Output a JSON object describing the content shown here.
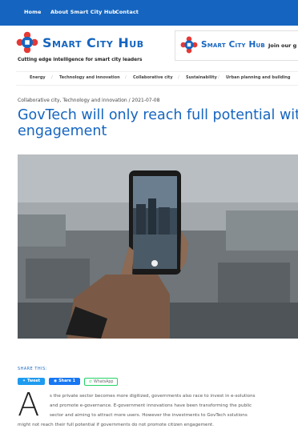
{
  "topnav": {
    "links": [
      "Home",
      "About Smart City Hub",
      "Contact"
    ]
  },
  "brand": {
    "name": "Smart City Hub",
    "tagline": "Cutting edge intelligence for smart city leaders"
  },
  "banner": {
    "brand": "Smart City Hub",
    "cta": "Join our g"
  },
  "categories": [
    "Energy",
    "Technology and innovation",
    "Collaborative city",
    "Sustainability",
    "Urban planning and building"
  ],
  "article": {
    "breadcrumb": "Collaborative city, Technology and innovation / 2021-07-08",
    "title_line1": "GovTech will only reach full potential with",
    "title_line2": "engagement",
    "share_label": "SHARE THIS:",
    "share_buttons": {
      "tweet": "Tweet",
      "share": "Share 1",
      "whatsapp": "WhatsApp"
    },
    "dropcap": "A",
    "body_lines": [
      "s the private sector becomes more digitized, governments also race to invest in e-solutions",
      "and promote e-governance. E-government innovations have been transforming the public",
      "sector and aiming to attract more users. However the investments to GovTech solutions",
      "might not reach their full potential if governments do not promote citizen engagement."
    ]
  },
  "colors": {
    "brand_blue": "#1565c0",
    "tweet_blue": "#1d9bf0",
    "facebook_blue": "#1877f2",
    "whatsapp_green": "#25d366"
  },
  "icons": [
    "smart-city-hub-logo",
    "twitter-icon",
    "facebook-icon",
    "whatsapp-icon"
  ]
}
